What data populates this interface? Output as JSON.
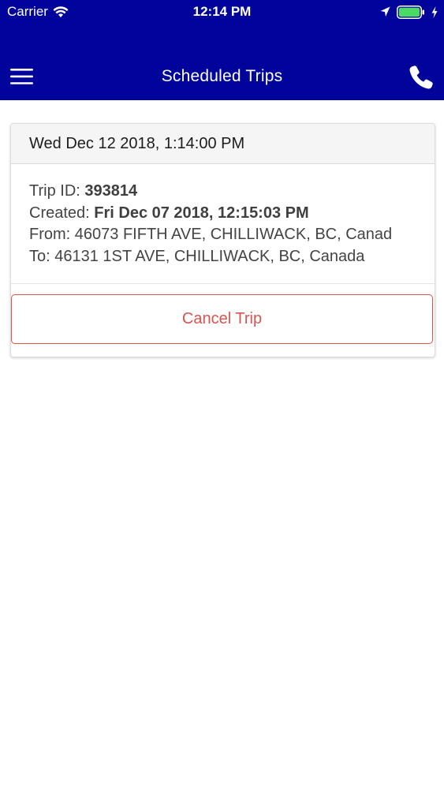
{
  "status_bar": {
    "carrier": "Carrier",
    "time": "12:14 PM",
    "icons": [
      "wifi-icon",
      "location-arrow-icon",
      "battery-icon",
      "charging-bolt-icon"
    ],
    "battery_color": "#4cd964"
  },
  "nav": {
    "title": "Scheduled Trips",
    "menu_icon": "hamburger-menu-icon",
    "call_icon": "phone-icon",
    "background_color": "#01049a"
  },
  "trip": {
    "date": "Wed Dec 12 2018, 1:14:00 PM",
    "trip_id_label": "Trip ID: ",
    "trip_id": "393814",
    "created_label": "Created: ",
    "created": "Fri Dec 07 2018, 12:15:03 PM",
    "from_label": "From: ",
    "from": "46073 FIFTH AVE, CHILLIWACK, BC, Canad",
    "to_label": "To: ",
    "to": "46131 1ST AVE, CHILLIWACK, BC, Canada",
    "cancel_label": "Cancel Trip",
    "cancel_color": "#d9534f"
  }
}
